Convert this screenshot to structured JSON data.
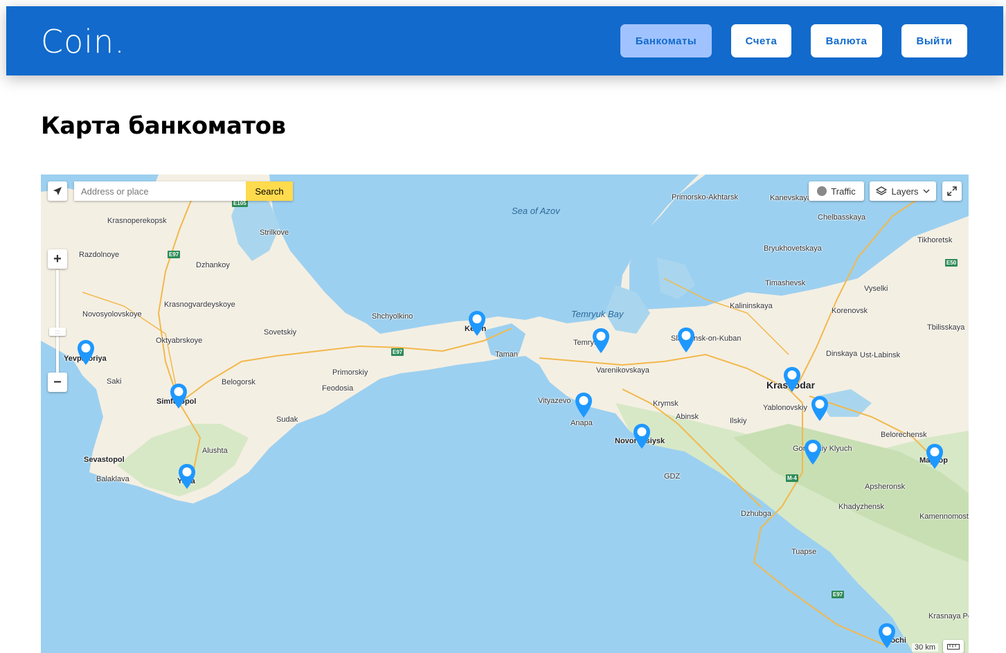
{
  "header": {
    "logo": "Coin.",
    "nav": [
      {
        "label": "Банкоматы",
        "active": true
      },
      {
        "label": "Счета",
        "active": false
      },
      {
        "label": "Валюта",
        "active": false
      },
      {
        "label": "Выйти",
        "active": false
      }
    ]
  },
  "page": {
    "title": "Карта банкоматов"
  },
  "map": {
    "search": {
      "placeholder": "Address or place",
      "button": "Search"
    },
    "controls": {
      "traffic": "Traffic",
      "layers": "Layers",
      "zoom_in": "+",
      "zoom_out": "−"
    },
    "scale_label": "30 km",
    "water_labels": [
      "Sea of Azov",
      "Temryuk Bay"
    ],
    "places": [
      "Krasnoperekopsk",
      "Strilkove",
      "Razdolnoye",
      "Dzhankoy",
      "Krasnogvardeyskoye",
      "Novosyolovskoye",
      "Oktyabrskoye",
      "Sovetskiy",
      "Yevpatoriya",
      "Saki",
      "Simferopol",
      "Belogorsk",
      "Feodosia",
      "Sudak",
      "Alushta",
      "Sevastopol",
      "Balaklava",
      "Yalta",
      "Shchyolkino",
      "Kerch",
      "Primorskiy",
      "Taman",
      "Temryuk",
      "Varenikovskaya",
      "Vityazevo",
      "Anapa",
      "Krymsk",
      "Abinsk",
      "Novorossiysk",
      "GDZ",
      "Ilskiy",
      "Slavyansk-on-Kuban",
      "Primorsko-Akhtarsk",
      "Kanevskaya",
      "Chelbasskaya",
      "Bryukhovetskaya",
      "Timashevsk",
      "Kalininskaya",
      "Korenovsk",
      "Tikhoretsk",
      "Vyselki",
      "Dinskaya",
      "Tbilisskaya",
      "Ust-Labinsk",
      "Krasnodar",
      "Yablonovskiy",
      "Goryachiy Klyuch",
      "Belorechensk",
      "Maykop",
      "Apsheronsk",
      "Khadyzhensk",
      "Kamennomostsk",
      "Dzhubga",
      "Tuapse",
      "Sochi",
      "Krasnaya Polyana"
    ],
    "roads": [
      "E105",
      "E97",
      "E97",
      "E50",
      "M-4",
      "E97"
    ],
    "markers": [
      {
        "city": "Kerch"
      },
      {
        "city": "Yevpatoriya"
      },
      {
        "city": "Simferopol"
      },
      {
        "city": "Yalta"
      },
      {
        "city": "Temryuk"
      },
      {
        "city": "Slavyansk-on-Kuban"
      },
      {
        "city": "Anapa"
      },
      {
        "city": "Novorossiysk"
      },
      {
        "city": "Krasnodar"
      },
      {
        "city": "Krasnodar East"
      },
      {
        "city": "Goryachiy Klyuch"
      },
      {
        "city": "Maykop"
      },
      {
        "city": "Sochi"
      }
    ],
    "colors": {
      "sea": "#9cd0f0",
      "land": "#f4efe3",
      "marker": "#1e98ff"
    }
  }
}
